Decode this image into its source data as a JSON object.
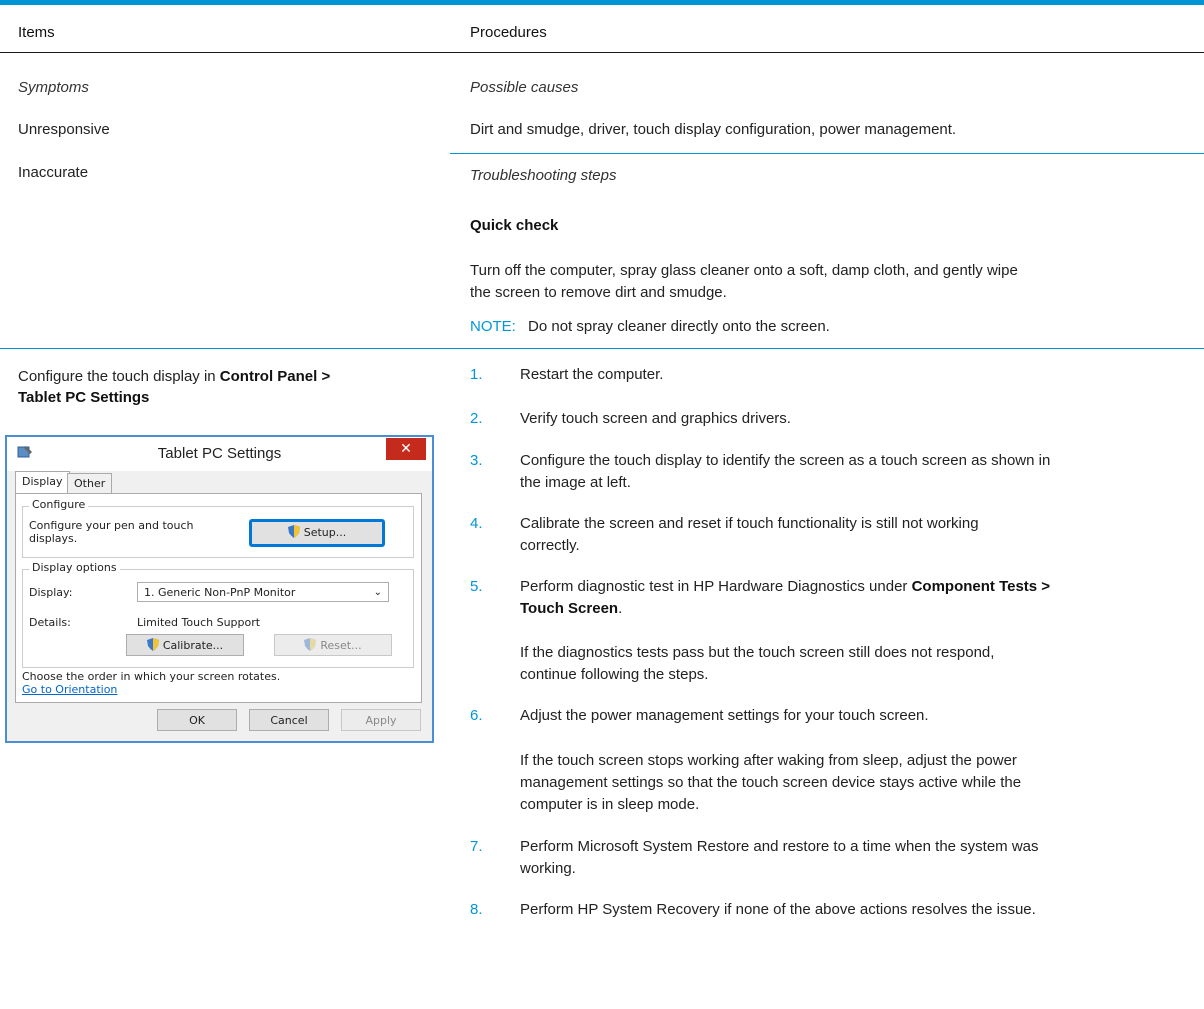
{
  "table": {
    "col1_header": "Items",
    "col2_header": "Procedures",
    "symptoms_label": "Symptoms",
    "causes_label": "Possible causes",
    "symptom1": "Unresponsive",
    "symptom2": "Inaccurate",
    "causes_text": "Dirt and smudge, driver, touch display configuration, power management.",
    "troubleshooting_label": "Troubleshooting steps",
    "quick_check_title": "Quick check",
    "quick_check_line1": "Turn off the computer, spray glass cleaner onto a soft, damp cloth, and gently wipe",
    "quick_check_line2": "the screen to remove dirt and smudge.",
    "note_label": "NOTE:",
    "note_text": "Do not spray cleaner directly onto the screen.",
    "configure_prefix": "Configure the touch display in ",
    "configure_bold1": "Control Panel >",
    "configure_bold2": "Tablet PC Settings"
  },
  "steps": [
    {
      "num": "1.",
      "lines": [
        "Restart the computer."
      ]
    },
    {
      "num": "2.",
      "lines": [
        "Verify touch screen and graphics drivers."
      ]
    },
    {
      "num": "3.",
      "lines": [
        "Configure the touch display to identify the screen as a touch screen as shown in",
        "the image at left."
      ]
    },
    {
      "num": "4.",
      "lines": [
        "Calibrate the screen and reset if touch functionality is still not working",
        "correctly."
      ]
    },
    {
      "num": "5.",
      "line1_prefix": "Perform diagnostic test in HP Hardware Diagnostics under ",
      "line1_bold": "Component Tests >",
      "line2_bold": "Touch Screen",
      "line2_suffix": ".",
      "para_lines": [
        "If the diagnostics tests pass but the touch screen still does not respond,",
        "continue following the steps."
      ]
    },
    {
      "num": "6.",
      "lines": [
        "Adjust the power management settings for your touch screen."
      ],
      "para_lines": [
        "If the touch screen stops working after waking from sleep, adjust the power",
        "management settings so that the touch screen device stays active while the",
        "computer is in sleep mode."
      ]
    },
    {
      "num": "7.",
      "lines": [
        "Perform Microsoft System Restore and restore to a time when the system was",
        "working."
      ]
    },
    {
      "num": "8.",
      "lines": [
        "Perform HP System Recovery if none of the above actions resolves the issue."
      ]
    }
  ],
  "dialog": {
    "title": "Tablet PC Settings",
    "close": "✕",
    "tab_display": "Display",
    "tab_other": "Other",
    "configure_group": "Configure",
    "configure_text_line1": "Configure your pen and touch",
    "configure_text_line2": "displays.",
    "setup_button": "Setup...",
    "display_options_group": "Display options",
    "display_label": "Display:",
    "display_value": "1. Generic Non-PnP Monitor",
    "details_label": "Details:",
    "details_value": "Limited Touch Support",
    "calibrate_button": "Calibrate...",
    "reset_button": "Reset...",
    "orientation_text": "Choose the order in which your screen rotates.",
    "orientation_link": "Go to Orientation",
    "ok_button": "OK",
    "cancel_button": "Cancel",
    "apply_button": "Apply"
  },
  "colors": {
    "accent": "#0096d6",
    "close_red": "#c42b1c",
    "link": "#0066cc"
  }
}
